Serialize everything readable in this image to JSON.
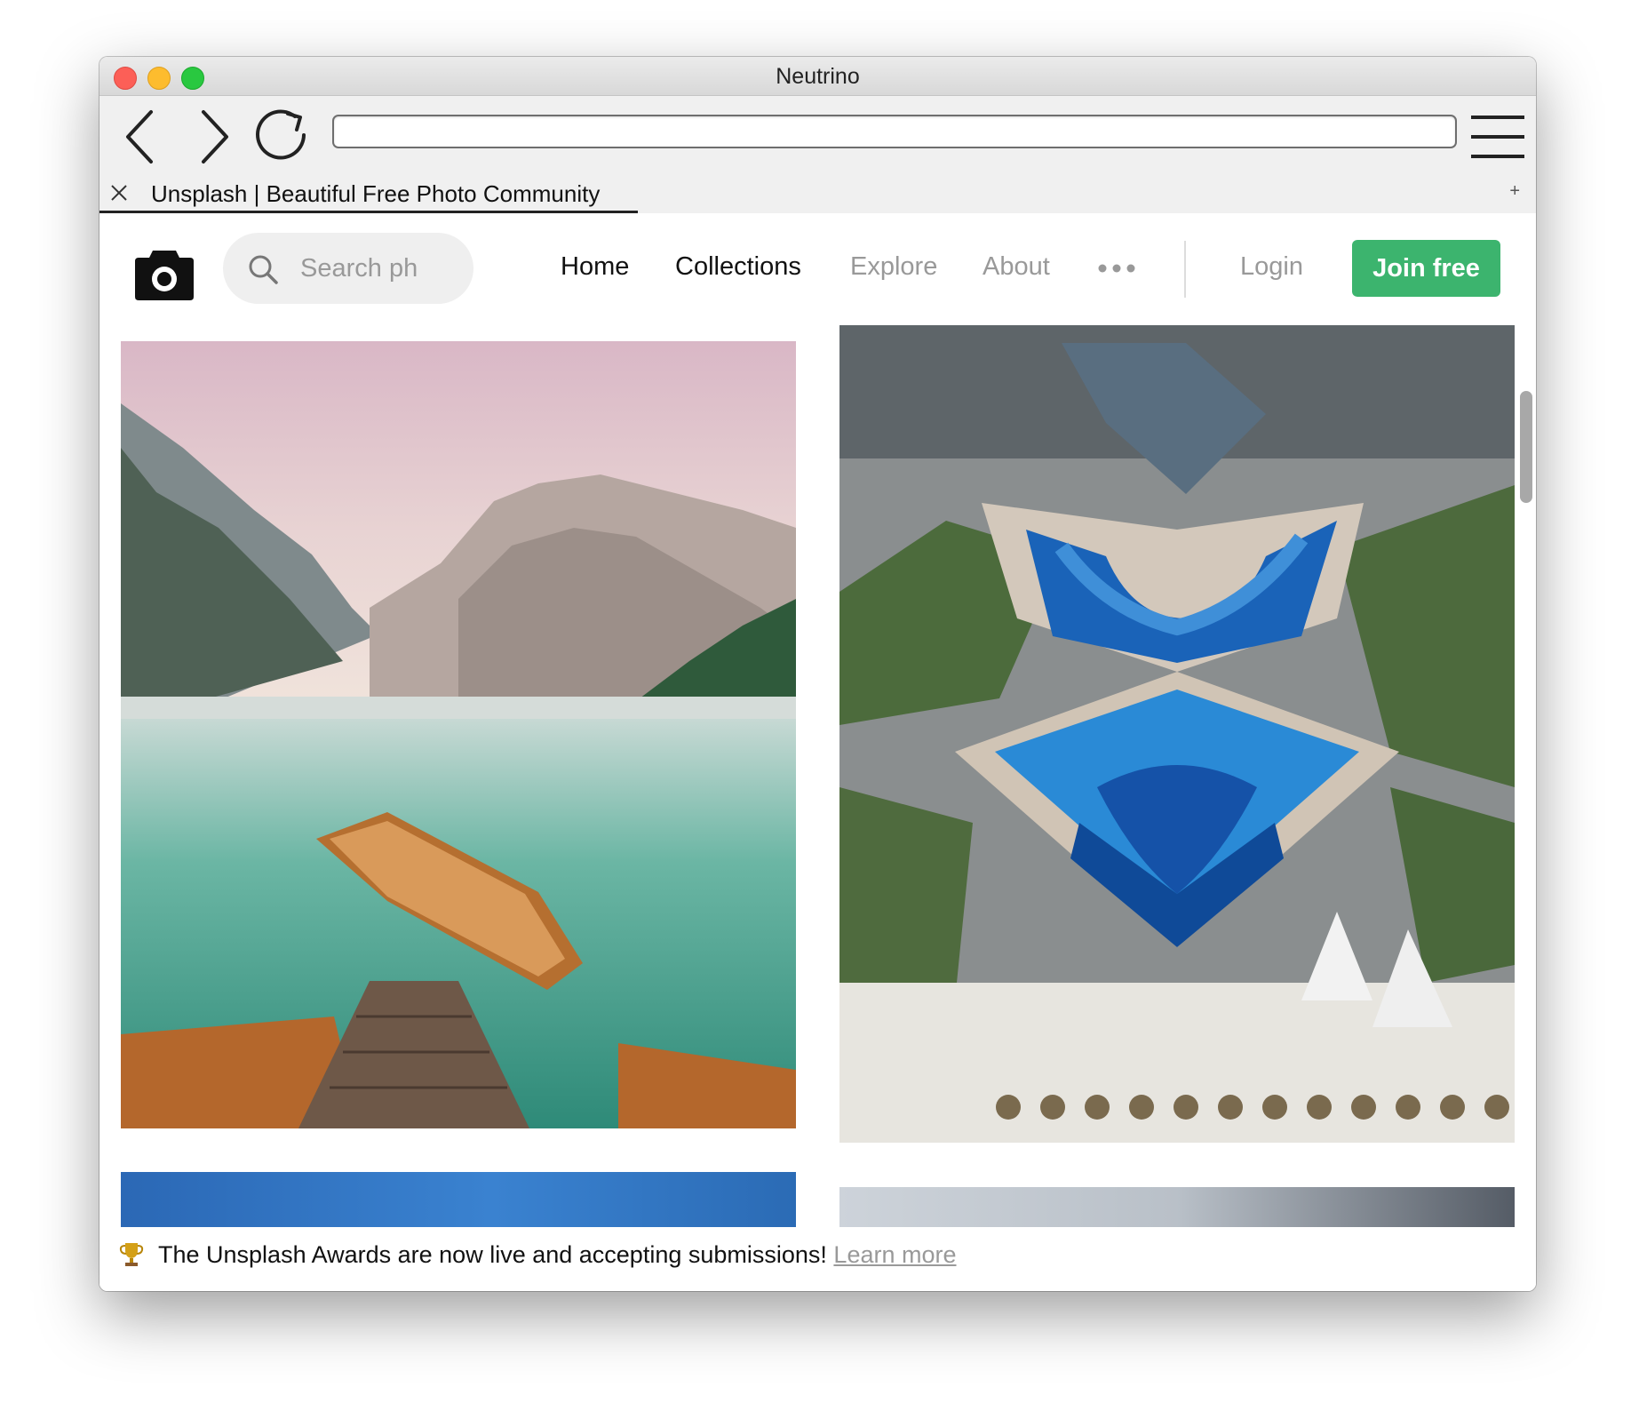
{
  "window": {
    "title": "Neutrino"
  },
  "toolbar": {
    "back_icon": "chevron-left-icon",
    "forward_icon": "chevron-right-icon",
    "reload_icon": "reload-icon",
    "menu_icon": "hamburger-menu-icon",
    "address_value": ""
  },
  "tabs": [
    {
      "title": "Unsplash | Beautiful Free Photo Community",
      "active": true
    }
  ],
  "new_tab_label": "+",
  "site": {
    "logo_icon": "camera-icon",
    "search_placeholder": "Search ph",
    "nav": {
      "home": "Home",
      "collections": "Collections",
      "explore": "Explore",
      "about": "About",
      "more_icon": "more-dots-icon"
    },
    "login": "Login",
    "join": "Join free",
    "brand_color": "#3cb46e"
  },
  "photos": [
    {
      "subject": "mountain-lake-boats"
    },
    {
      "subject": "aerial-resort-pools"
    },
    {
      "subject": "blue-gradient"
    },
    {
      "subject": "cloudy-sky"
    }
  ],
  "banner": {
    "icon": "trophy-icon",
    "text": "The Unsplash Awards are now live and accepting submissions!",
    "link": "Learn more"
  }
}
